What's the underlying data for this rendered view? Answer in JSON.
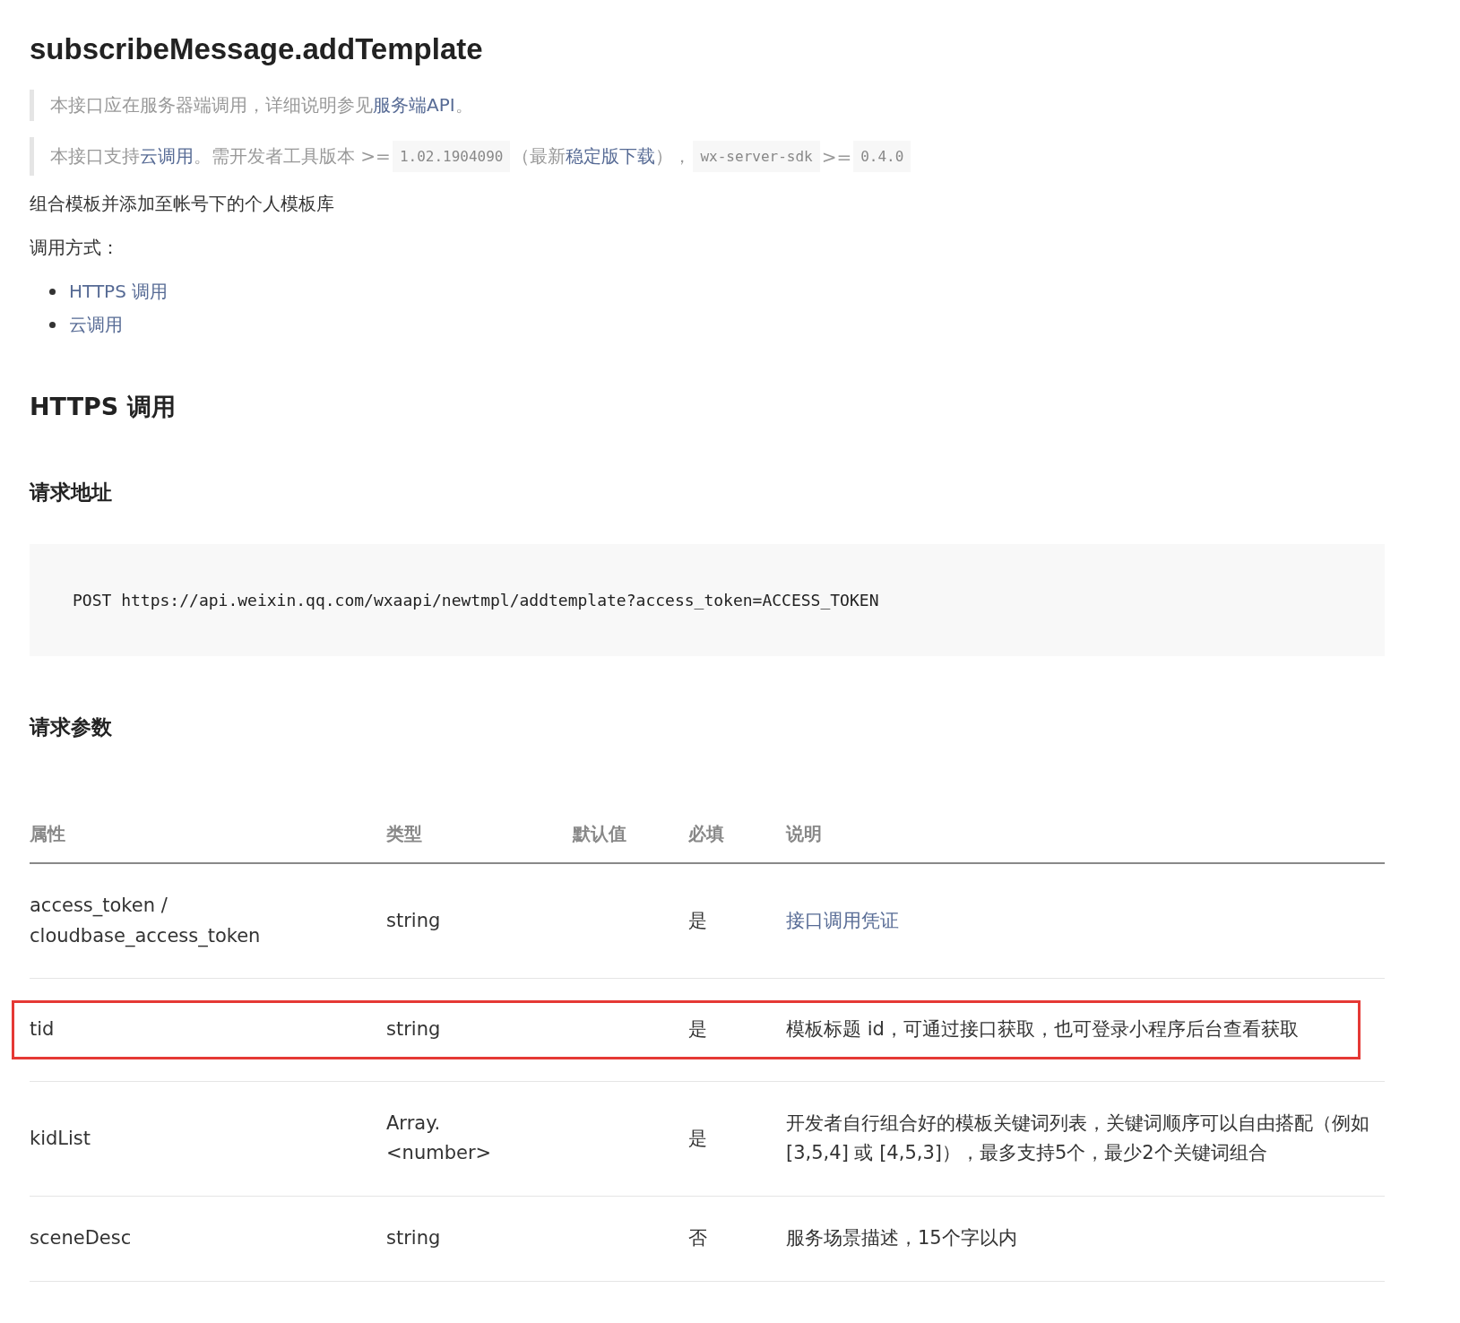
{
  "title": "subscribeMessage.addTemplate",
  "notes": [
    [
      {
        "kind": "text",
        "text": "本接口应在服务器端调用，详细说明参见"
      },
      {
        "kind": "link",
        "text": "服务端API"
      },
      {
        "kind": "text",
        "text": "。"
      }
    ],
    [
      {
        "kind": "text",
        "text": "本接口支持"
      },
      {
        "kind": "link",
        "text": "云调用"
      },
      {
        "kind": "text",
        "text": "。需开发者工具版本 >= "
      },
      {
        "kind": "code",
        "text": "1.02.1904090"
      },
      {
        "kind": "text",
        "text": " （最新"
      },
      {
        "kind": "link",
        "text": "稳定版下载"
      },
      {
        "kind": "text",
        "text": "）， "
      },
      {
        "kind": "code",
        "text": "wx-server-sdk"
      },
      {
        "kind": "text",
        "text": " >= "
      },
      {
        "kind": "code",
        "text": "0.4.0"
      }
    ]
  ],
  "description": "组合模板并添加至帐号下的个人模板库",
  "call_label": "调用方式：",
  "call_links": [
    "HTTPS 调用",
    "云调用"
  ],
  "section_heading": "HTTPS 调用",
  "request_url_heading": "请求地址",
  "request_url_code": "POST https://api.weixin.qq.com/wxaapi/newtmpl/addtemplate?access_token=ACCESS_TOKEN",
  "params_heading": "请求参数",
  "table": {
    "columns": [
      "属性",
      "类型",
      "默认值",
      "必填",
      "说明"
    ],
    "rows": [
      {
        "name": [
          "access_token /",
          "cloudbase_access_token"
        ],
        "type": [
          "string"
        ],
        "default": "",
        "required": "是",
        "description": "接口调用凭证",
        "description_is_link": true,
        "highlighted": false
      },
      {
        "name": [
          "tid"
        ],
        "type": [
          "string"
        ],
        "default": "",
        "required": "是",
        "description": "模板标题 id，可通过接口获取，也可登录小程序后台查看获取",
        "description_is_link": false,
        "highlighted": true
      },
      {
        "name": [
          "kidList"
        ],
        "type": [
          "Array.",
          "<number>"
        ],
        "default": "",
        "required": "是",
        "description": "开发者自行组合好的模板关键词列表，关键词顺序可以自由搭配（例如 [3,5,4] 或 [4,5,3]），最多支持5个，最少2个关键词组合",
        "description_is_link": false,
        "highlighted": false
      },
      {
        "name": [
          "sceneDesc"
        ],
        "type": [
          "string"
        ],
        "default": "",
        "required": "否",
        "description": "服务场景描述，15个字以内",
        "description_is_link": false,
        "highlighted": false
      }
    ]
  }
}
